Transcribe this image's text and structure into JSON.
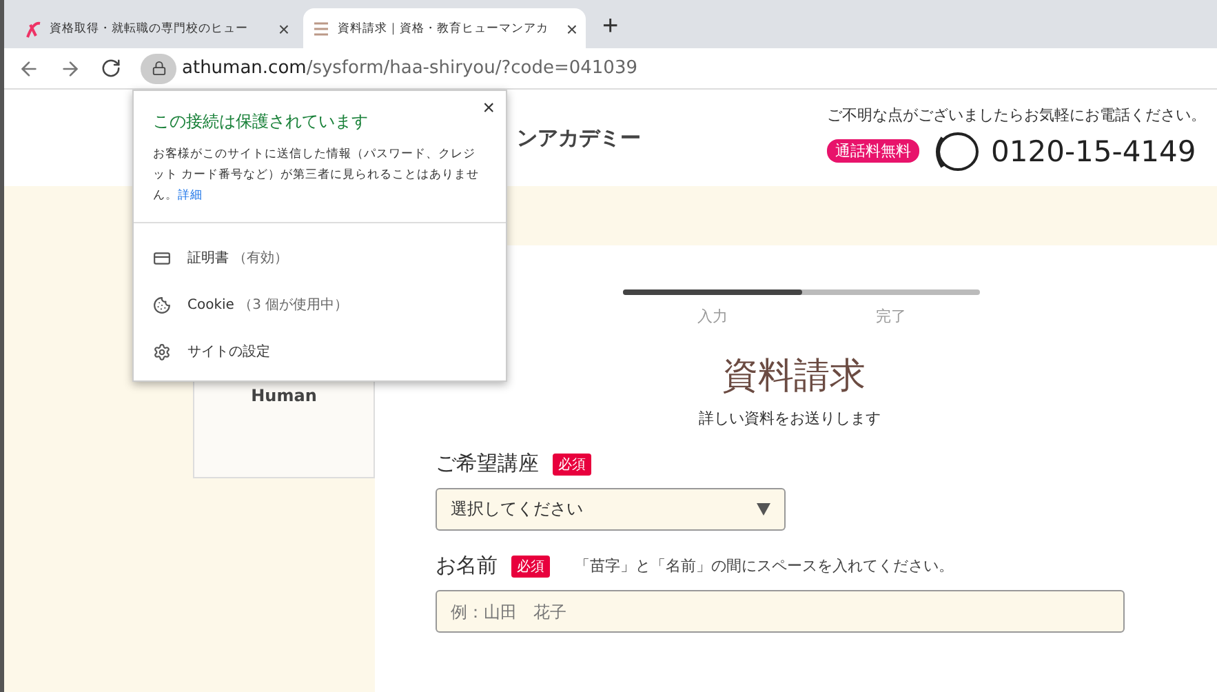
{
  "browser": {
    "tabs": [
      {
        "title": "資格取得・就転職の専門校のヒュー",
        "close": "×",
        "selected": false
      },
      {
        "title": "資料請求｜資格・教育ヒューマンアカ",
        "close": "×",
        "selected": true
      }
    ],
    "new_tab": "+",
    "url": {
      "host": "athuman.com",
      "path": "/sysform/haa-shiryou/?code=041039"
    }
  },
  "popup": {
    "title": "この接続は保護されています",
    "body": "お客様がこのサイトに送信した情報（パスワード、クレジット カード番号など）が第三者に見られることはありません。",
    "link": "詳細",
    "close": "×",
    "items": [
      {
        "kind": "certificate",
        "label": "証明書",
        "note": "（有効）"
      },
      {
        "kind": "cookie",
        "label": "Cookie",
        "note": "（3 個が使用中）"
      },
      {
        "kind": "settings",
        "label": "サイトの設定"
      }
    ]
  },
  "header": {
    "logo": "ンアカデミー",
    "notice": "ご不明な点がございましたらお気軽にお電話ください。",
    "badge": "通話料無料",
    "phone": "0120-15-4149"
  },
  "sidebar": {
    "card_text": "Human"
  },
  "progress": {
    "level": 0.5,
    "steps": [
      "入力",
      "完了"
    ]
  },
  "form": {
    "title": "資料請求",
    "subtitle": "詳しい資料をお送りします",
    "fields": [
      {
        "kind": "select",
        "label": "ご希望講座",
        "required": "必須",
        "value": "選択してください"
      },
      {
        "kind": "text",
        "label": "お名前",
        "required": "必須",
        "hint": "「苗字」と「名前」の間にスペースを入れてください。",
        "placeholder": "例：山田　花子"
      }
    ]
  }
}
